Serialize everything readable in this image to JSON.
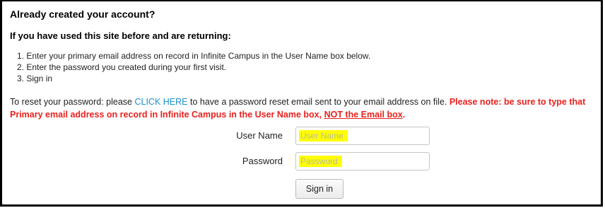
{
  "heading": "Already created your account?",
  "subheading": "If you have used this site before and are returning:",
  "steps": [
    "1. Enter your primary email address on record in Infinite Campus in the User Name box below.",
    "2. Enter the password you created during your first visit.",
    "3. Sign in"
  ],
  "reset": {
    "prefix": "To reset your password:  please ",
    "link": "CLICK HERE",
    "middle": " to have a password reset email sent to your email address on file. ",
    "note_main": "Please note: be sure to type that  Primary email address on record in Infinite Campus in the User Name box, ",
    "note_underlined": "NOT the Email box",
    "note_end": "."
  },
  "form": {
    "username_label": "User Name",
    "username_placeholder": "User Name",
    "password_label": "Password",
    "password_placeholder": "Password",
    "signin_label": "Sign in"
  },
  "colors": {
    "link": "#1a8fc9",
    "note": "#e8221e",
    "highlight": "#ffff00"
  }
}
